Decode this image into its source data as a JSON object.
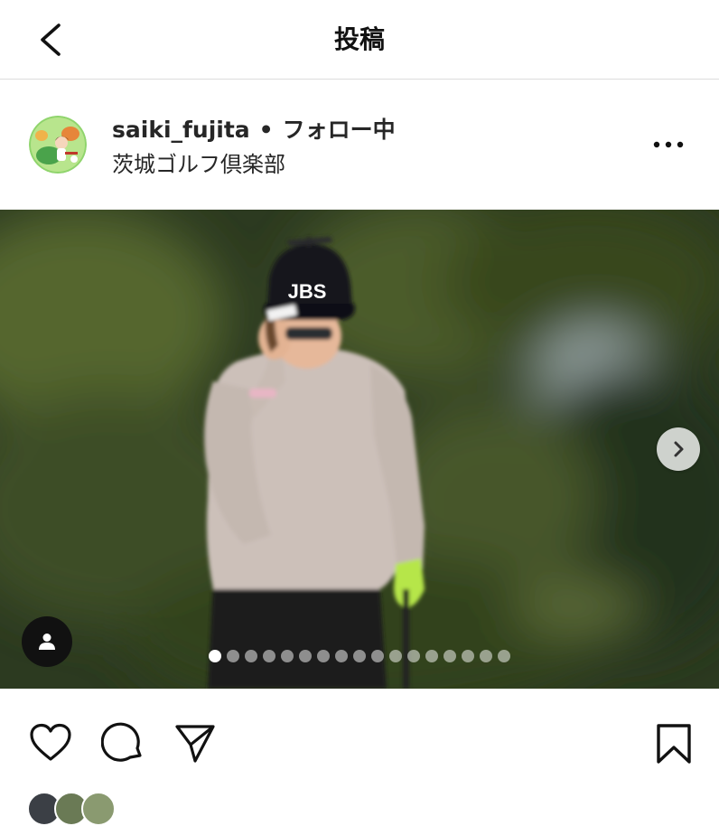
{
  "header": {
    "title": "投稿",
    "back_icon": "chevron-left-icon"
  },
  "post": {
    "username": "saiki_fujita",
    "separator": "•",
    "follow_status": "フォロー中",
    "location": "茨城ゴルフ倶楽部",
    "more_icon": "more-horizontal-icon"
  },
  "carousel": {
    "slide_count": 17,
    "active_index": 0,
    "next_icon": "chevron-right-icon",
    "tag_icon": "user-tag-icon",
    "cap_text": "JBS"
  },
  "actions": {
    "icons": [
      "heart-icon",
      "comment-icon",
      "share-icon",
      "bookmark-icon"
    ]
  }
}
